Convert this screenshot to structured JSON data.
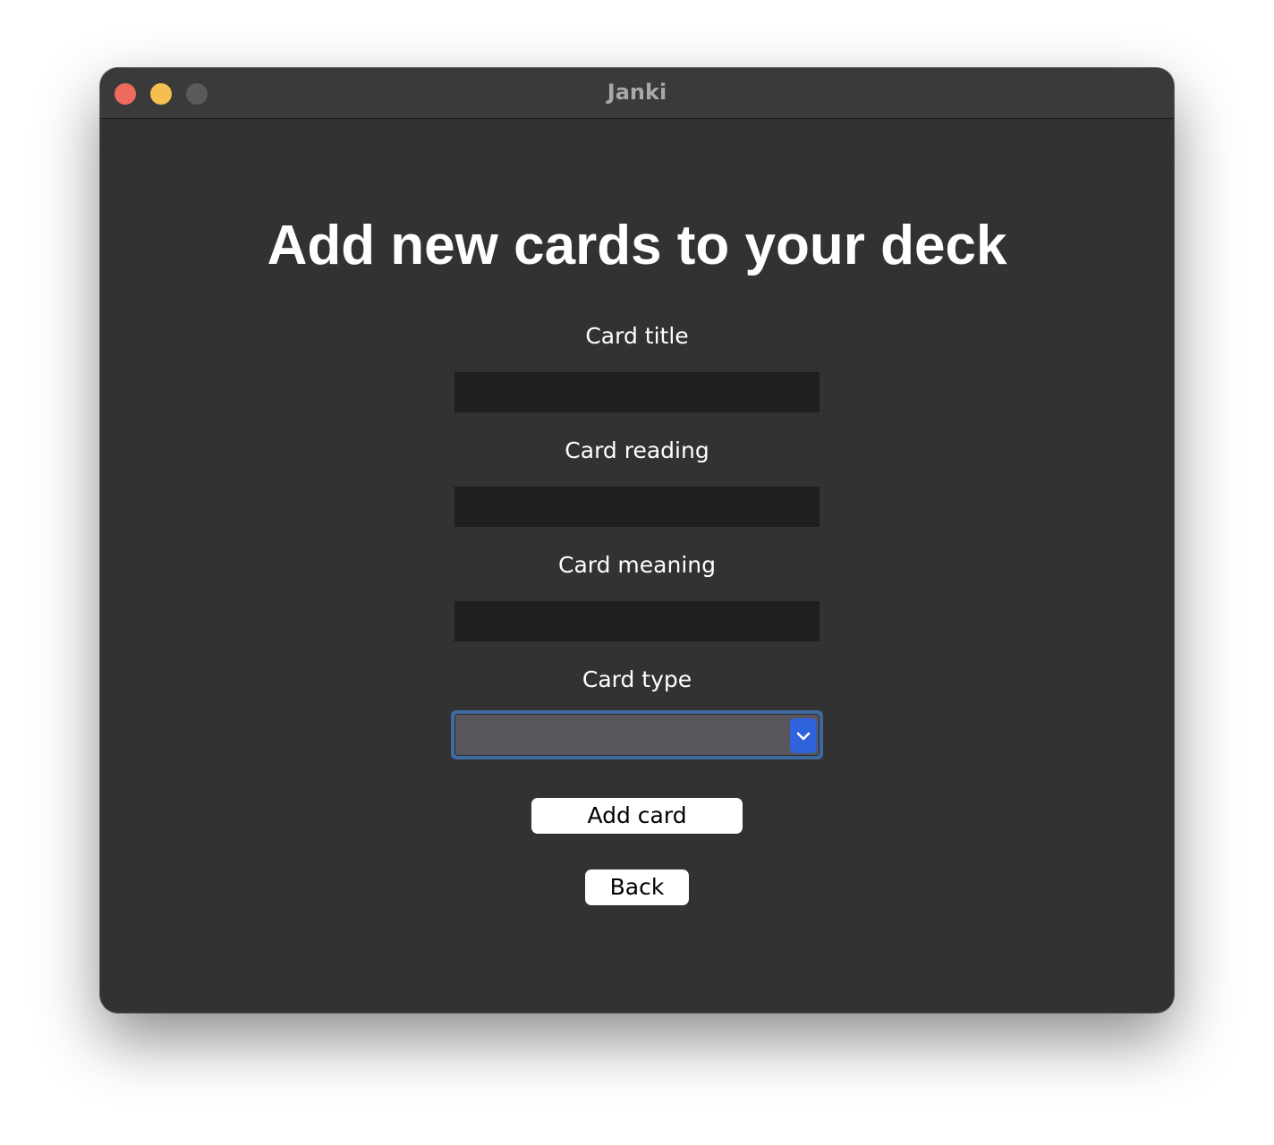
{
  "window": {
    "title": "Janki"
  },
  "form": {
    "heading": "Add new cards to your deck",
    "fields": [
      {
        "label": "Card title",
        "value": ""
      },
      {
        "label": "Card reading",
        "value": ""
      },
      {
        "label": "Card meaning",
        "value": ""
      }
    ],
    "type_select": {
      "label": "Card type",
      "value": ""
    }
  },
  "buttons": {
    "add_label": "Add card",
    "back_label": "Back"
  },
  "icons": {
    "window_controls": [
      "close-icon",
      "minimize-icon",
      "zoom-icon"
    ],
    "select_arrow": "chevron-down-icon"
  },
  "colors": {
    "window_bg": "#323232",
    "titlebar_bg": "#3a3a3a",
    "input_bg": "#1f1f1f",
    "select_focus": "#3f6aa0",
    "select_arrow_bg": "#2f62dd",
    "close": "#ec6a5e",
    "minimize": "#f4bf4f",
    "zoom_inactive": "#5a5a5a"
  }
}
